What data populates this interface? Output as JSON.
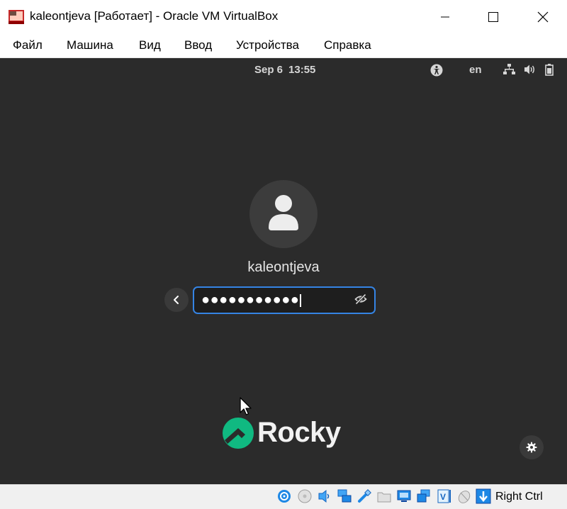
{
  "window": {
    "title": "kaleontjeva [Работает] - Oracle VM VirtualBox"
  },
  "menu": {
    "items": [
      "Файл",
      "Машина",
      "Вид",
      "Ввод",
      "Устройства",
      "Справка"
    ]
  },
  "guest": {
    "topbar": {
      "date": "Sep 6",
      "time": "13:55",
      "language": "en"
    },
    "login": {
      "username": "kaleontjeva",
      "password_mask": "●●●●●●●●●●●"
    },
    "logo_text": "Rocky"
  },
  "statusbar": {
    "host_key": "Right Ctrl"
  },
  "colors": {
    "vm_background": "#2b2b2b",
    "accent_focus": "#3584e4",
    "rocky_green": "#10b981"
  }
}
